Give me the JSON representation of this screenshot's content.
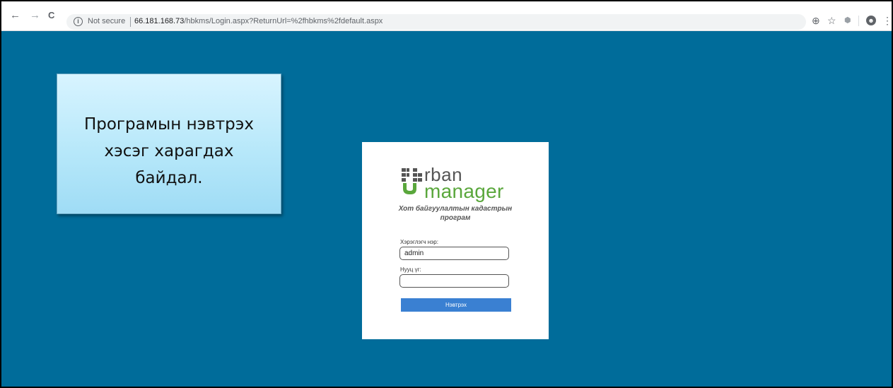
{
  "browser": {
    "back_icon": "←",
    "forward_icon": "→",
    "reload_icon": "C",
    "security_label": "Not secure",
    "url_host": "66.181.168.73",
    "url_path": "/hbkms/Login.aspx?ReturnUrl=%2fhbkms%2fdefault.aspx",
    "zoom_icon": "⊕",
    "star_icon": "☆",
    "account_icon": "●",
    "menu_icon": "⋮"
  },
  "callout": {
    "line1": "Програмын нэвтрэх",
    "line2": "хэсэг харагдах",
    "line3": "байдал."
  },
  "login": {
    "logo_rban": "rban",
    "logo_manager": "manager",
    "subtitle_line1": "Хот байгуулалтын кадастрын",
    "subtitle_line2": "програм",
    "username_label": "Хэрэглэгч нэр:",
    "username_value": "admin",
    "password_label": "Нууц үг:",
    "password_value": "",
    "submit_label": "Нэвтрэх"
  },
  "colors": {
    "page_background": "#006c9a",
    "login_button": "#3a80d2",
    "logo_green": "#5aa73c"
  }
}
